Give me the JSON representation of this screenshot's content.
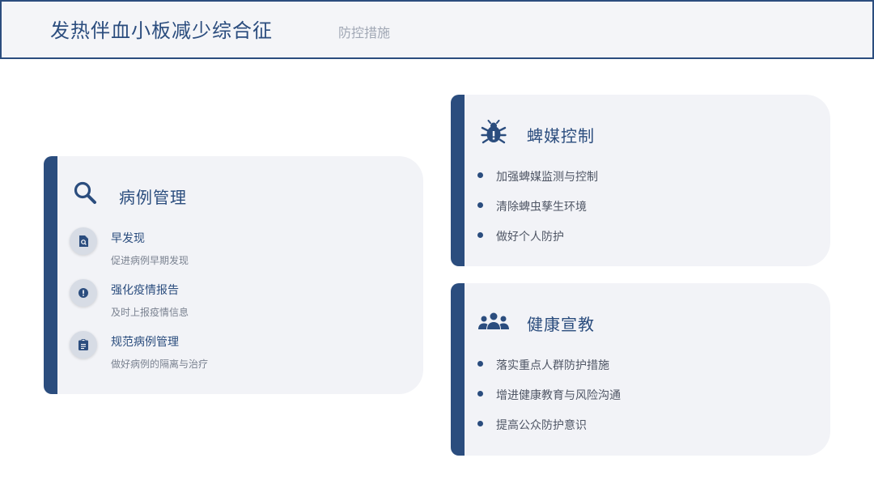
{
  "header": {
    "title": "发热伴血小板减少综合征",
    "subtitle": "防控措施"
  },
  "case_management": {
    "title": "病例管理",
    "icon": "search-icon",
    "items": [
      {
        "title": "早发现",
        "desc": "促进病例早期发现",
        "icon": "file-search-icon"
      },
      {
        "title": "强化疫情报告",
        "desc": "及时上报疫情信息",
        "icon": "alert-icon"
      },
      {
        "title": "规范病例管理",
        "desc": "做好病例的隔离与治疗",
        "icon": "clipboard-icon"
      }
    ]
  },
  "vector_control": {
    "title": "蜱媒控制",
    "icon": "bug-icon",
    "items": [
      "加强蜱媒监测与控制",
      "清除蜱虫孳生环境",
      "做好个人防护"
    ]
  },
  "health_education": {
    "title": "健康宣教",
    "icon": "group-icon",
    "items": [
      "落实重点人群防护措施",
      "增进健康教育与风险沟通",
      "提高公众防护意识"
    ]
  },
  "colors": {
    "primary": "#2b4d7e",
    "card_bg": "#f2f3f7",
    "header_bg": "#f4f5f8",
    "muted_text": "#a1a8b5"
  }
}
